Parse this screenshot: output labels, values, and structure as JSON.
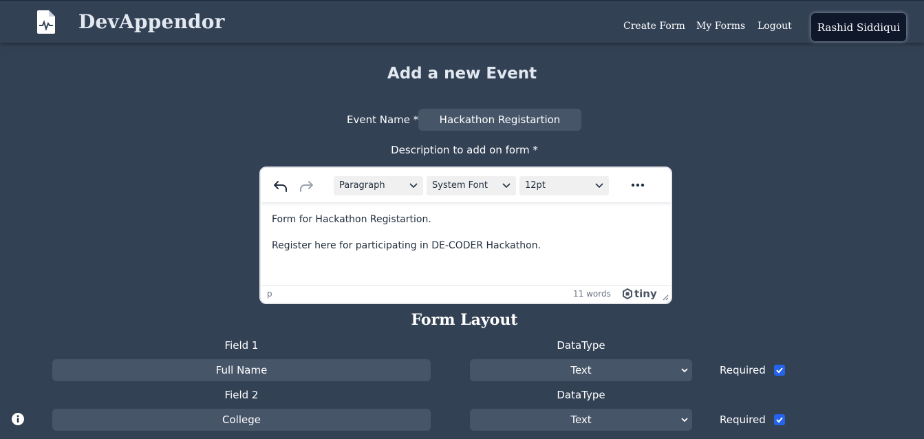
{
  "app": {
    "brand": "DevAppendor",
    "logo_icon": "file-waveform-icon"
  },
  "nav": {
    "create_form": "Create Form",
    "my_forms": "My Forms",
    "logout": "Logout",
    "user_name": "Rashid Siddiqui"
  },
  "page": {
    "title": "Add a new Event"
  },
  "event": {
    "name_label": "Event Name *",
    "name_value": "Hackathon Registartion",
    "description_label": "Description to add on form *"
  },
  "editor": {
    "toolbar": {
      "undo_icon": "undo-icon",
      "redo_icon": "redo-icon",
      "block_format": "Paragraph",
      "font_family": "System Font",
      "font_size": "12pt",
      "more_icon": "more-horizontal-icon"
    },
    "content": [
      "Form for Hackathon Registartion.",
      "Register here for participating in DE-CODER Hackathon."
    ],
    "status": {
      "path": "p",
      "word_count": "11 words",
      "brand": "tiny"
    }
  },
  "layout": {
    "title": "Form Layout",
    "fields": [
      {
        "label": "Field 1",
        "value": "Full Name",
        "datatype_label": "DataType",
        "datatype": "Text",
        "required_label": "Required",
        "required": true
      },
      {
        "label": "Field 2",
        "value": "College",
        "datatype_label": "DataType",
        "datatype": "Text",
        "required_label": "Required",
        "required": true
      }
    ]
  },
  "colors": {
    "background": "#334155",
    "input_bg": "#475569",
    "user_button_bg": "#0f172a",
    "checkbox": "#2563eb"
  }
}
